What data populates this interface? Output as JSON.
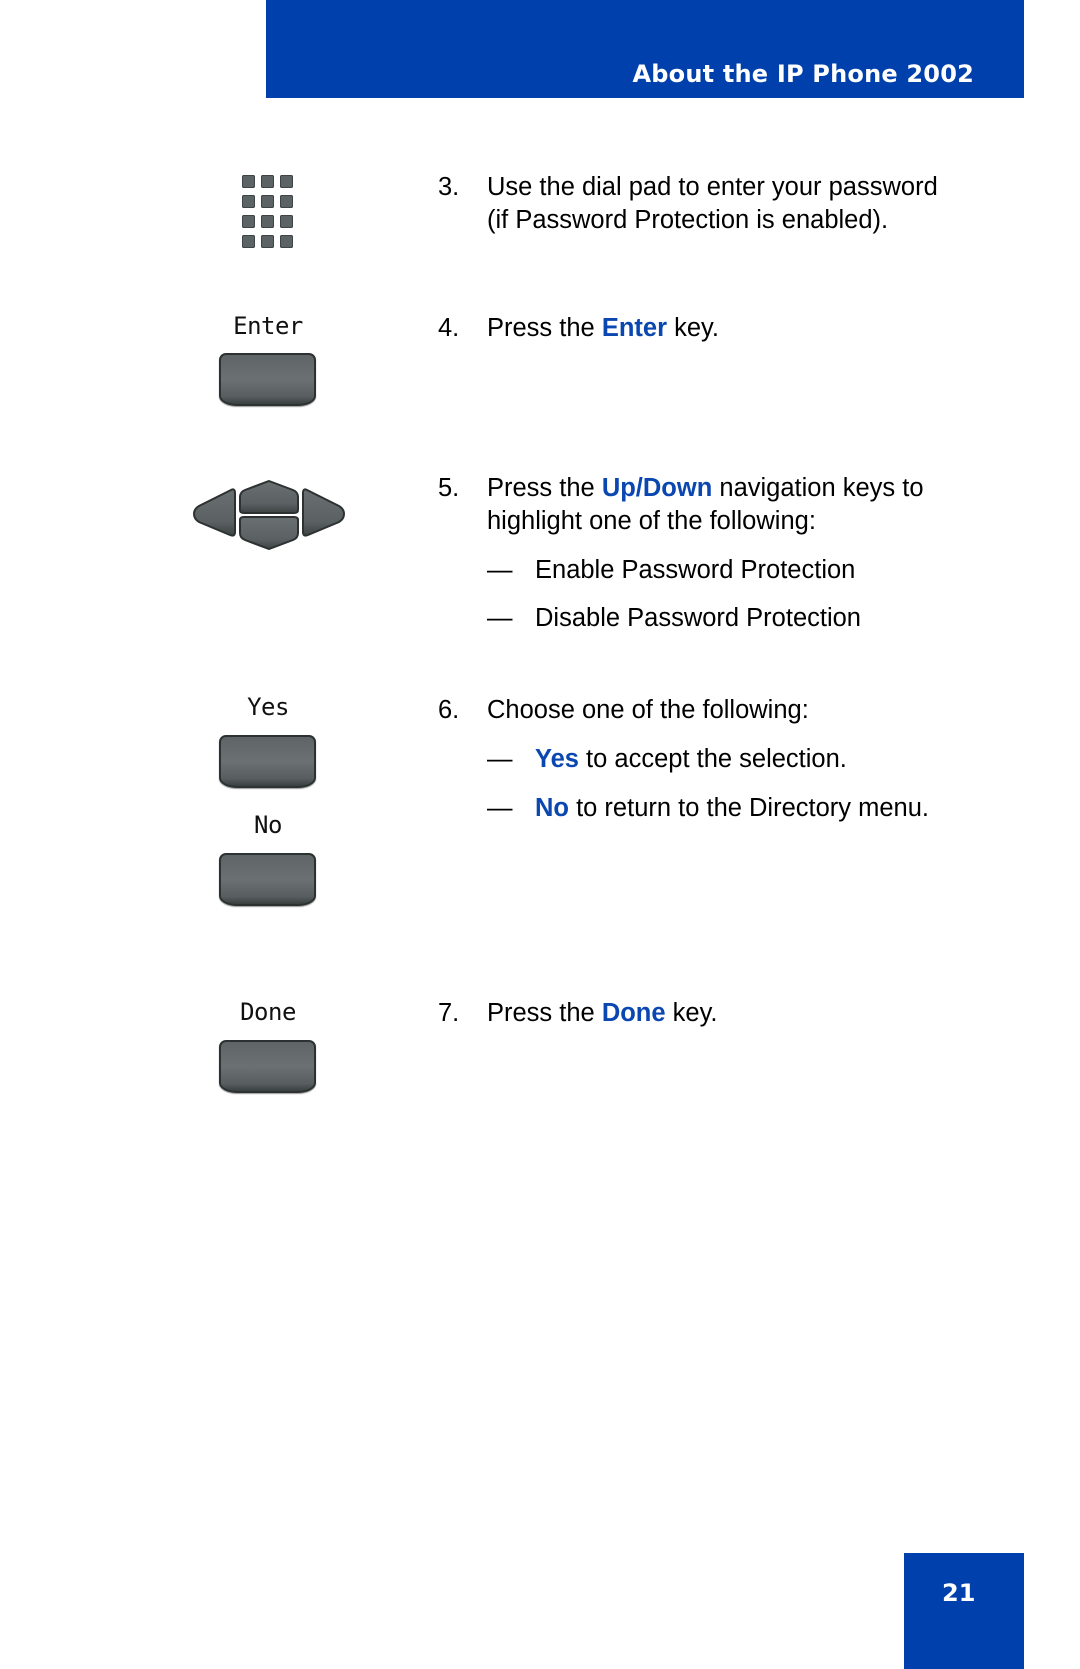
{
  "header": {
    "title": "About the IP Phone 2002"
  },
  "page_number": "21",
  "colors": {
    "brand_blue": "#0040ad",
    "highlight_text": "#0a47b0",
    "key_gray": "#5f6566"
  },
  "icons": {
    "dialpad": "dial-pad-icon",
    "navigation": "navigation-keys-icon",
    "softkey": "soft-key-icon"
  },
  "softkeys": {
    "enter": "Enter",
    "yes": "Yes",
    "no": "No",
    "done": "Done"
  },
  "steps": [
    {
      "number": "3.",
      "lines": [
        "Use the dial pad to enter your password",
        "(if Password Protection is enabled)."
      ]
    },
    {
      "number": "4.",
      "before": "Press the ",
      "highlight": "Enter",
      "after": " key."
    },
    {
      "number": "5.",
      "before": "Press the ",
      "highlight": "Up/Down",
      "after": " navigation keys to",
      "line2": "highlight one of the following:",
      "options": [
        {
          "dash": "—",
          "text": "Enable Password Protection"
        },
        {
          "dash": "—",
          "text": "Disable Password Protection"
        }
      ]
    },
    {
      "number": "6.",
      "text": "Choose one of the following:",
      "options": [
        {
          "dash": "—",
          "highlight": "Yes",
          "after": " to accept the selection."
        },
        {
          "dash": "—",
          "highlight": "No",
          "after": " to return to the Directory menu."
        }
      ]
    },
    {
      "number": "7.",
      "before": "Press the ",
      "highlight": "Done",
      "after": " key."
    }
  ]
}
